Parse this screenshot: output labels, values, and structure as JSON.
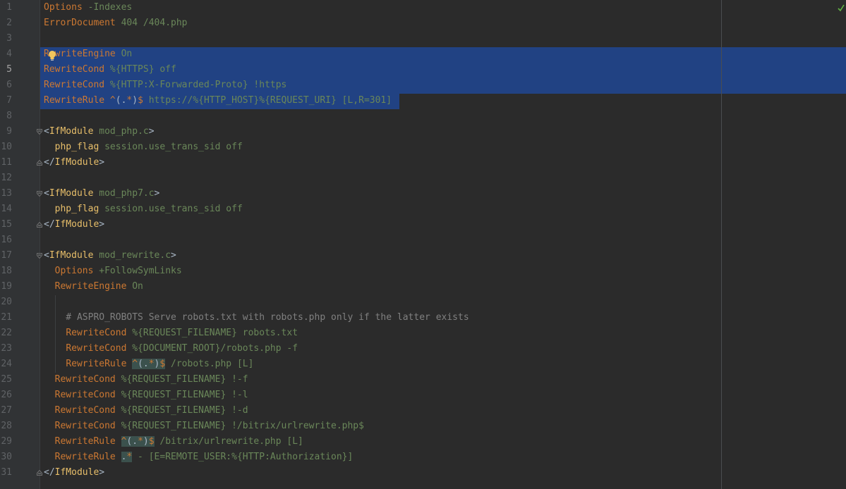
{
  "editor": {
    "current_line": 5,
    "status_icon": "check-icon",
    "lines": [
      {
        "num": "1",
        "seg": [
          {
            "t": "Options",
            "c": "kw"
          },
          {
            "t": " -Indexes",
            "c": "arg"
          }
        ]
      },
      {
        "num": "2",
        "seg": [
          {
            "t": "ErrorDocument",
            "c": "kw"
          },
          {
            "t": " 404 /404.php",
            "c": "arg"
          }
        ]
      },
      {
        "num": "3",
        "seg": []
      },
      {
        "num": "4",
        "seg": [
          {
            "t": "RewriteEngine",
            "c": "kw"
          },
          {
            "t": " On",
            "c": "arg"
          }
        ]
      },
      {
        "num": "5",
        "seg": [
          {
            "t": "RewriteCond",
            "c": "kw"
          },
          {
            "t": " %{HTTPS} off",
            "c": "arg"
          }
        ]
      },
      {
        "num": "6",
        "seg": [
          {
            "t": "RewriteCond",
            "c": "kw"
          },
          {
            "t": " %{HTTP:X-Forwarded-Proto} !https",
            "c": "arg"
          }
        ]
      },
      {
        "num": "7",
        "seg": [
          {
            "t": "RewriteRule",
            "c": "kw"
          },
          {
            "t": " ",
            "c": "arg"
          },
          {
            "t": "^",
            "c": "kw"
          },
          {
            "t": "(.",
            "c": "re"
          },
          {
            "t": "*",
            "c": "kw"
          },
          {
            "t": ")",
            "c": "re"
          },
          {
            "t": "$",
            "c": "kw"
          },
          {
            "t": " https://%{HTTP_HOST}%{REQUEST_URI} [L,R=301]",
            "c": "arg"
          }
        ]
      },
      {
        "num": "8",
        "seg": []
      },
      {
        "num": "9",
        "seg": [
          {
            "t": "<",
            "c": "re"
          },
          {
            "t": "IfModule",
            "c": "tag"
          },
          {
            "t": " mod_php.c",
            "c": "arg"
          },
          {
            "t": ">",
            "c": "re"
          }
        ],
        "fold": "open"
      },
      {
        "num": "10",
        "seg": [
          {
            "t": "  ",
            "c": "re"
          },
          {
            "t": "php_flag",
            "c": "tag"
          },
          {
            "t": " session.use_trans_sid off",
            "c": "arg"
          }
        ]
      },
      {
        "num": "11",
        "seg": [
          {
            "t": "</",
            "c": "re"
          },
          {
            "t": "IfModule",
            "c": "tag"
          },
          {
            "t": ">",
            "c": "re"
          }
        ],
        "fold": "close"
      },
      {
        "num": "12",
        "seg": []
      },
      {
        "num": "13",
        "seg": [
          {
            "t": "<",
            "c": "re"
          },
          {
            "t": "IfModule",
            "c": "tag"
          },
          {
            "t": " mod_php7.c",
            "c": "arg"
          },
          {
            "t": ">",
            "c": "re"
          }
        ],
        "fold": "open"
      },
      {
        "num": "14",
        "seg": [
          {
            "t": "  ",
            "c": "re"
          },
          {
            "t": "php_flag",
            "c": "tag"
          },
          {
            "t": " session.use_trans_sid off",
            "c": "arg"
          }
        ]
      },
      {
        "num": "15",
        "seg": [
          {
            "t": "</",
            "c": "re"
          },
          {
            "t": "IfModule",
            "c": "tag"
          },
          {
            "t": ">",
            "c": "re"
          }
        ],
        "fold": "close"
      },
      {
        "num": "16",
        "seg": []
      },
      {
        "num": "17",
        "seg": [
          {
            "t": "<",
            "c": "re"
          },
          {
            "t": "IfModule",
            "c": "tag"
          },
          {
            "t": " mod_rewrite.c",
            "c": "arg"
          },
          {
            "t": ">",
            "c": "re"
          }
        ],
        "fold": "open"
      },
      {
        "num": "18",
        "seg": [
          {
            "t": "  ",
            "c": "re"
          },
          {
            "t": "Options",
            "c": "kw"
          },
          {
            "t": " +FollowSymLinks",
            "c": "arg"
          }
        ]
      },
      {
        "num": "19",
        "seg": [
          {
            "t": "  ",
            "c": "re"
          },
          {
            "t": "RewriteEngine",
            "c": "kw"
          },
          {
            "t": " On",
            "c": "arg"
          }
        ]
      },
      {
        "num": "20",
        "seg": []
      },
      {
        "num": "21",
        "seg": [
          {
            "t": "    # ASPRO_ROBOTS Serve robots.txt with robots.php only if the latter exists",
            "c": "cmt"
          }
        ]
      },
      {
        "num": "22",
        "seg": [
          {
            "t": "    ",
            "c": "re"
          },
          {
            "t": "RewriteCond",
            "c": "kw"
          },
          {
            "t": " %{REQUEST_FILENAME} robots.txt",
            "c": "arg"
          }
        ]
      },
      {
        "num": "23",
        "seg": [
          {
            "t": "    ",
            "c": "re"
          },
          {
            "t": "RewriteCond",
            "c": "kw"
          },
          {
            "t": " %{DOCUMENT_ROOT}/robots.php -f",
            "c": "arg"
          }
        ]
      },
      {
        "num": "24",
        "seg": [
          {
            "t": "    ",
            "c": "re"
          },
          {
            "t": "RewriteRule",
            "c": "kw"
          },
          {
            "t": " ",
            "c": "arg"
          },
          {
            "t": "^",
            "c": "kw rx"
          },
          {
            "t": "(.",
            "c": "re rx"
          },
          {
            "t": "*",
            "c": "kw rx"
          },
          {
            "t": ")",
            "c": "re rx"
          },
          {
            "t": "$",
            "c": "kw rx"
          },
          {
            "t": " /robots.php [L]",
            "c": "arg"
          }
        ]
      },
      {
        "num": "25",
        "seg": [
          {
            "t": "  ",
            "c": "re"
          },
          {
            "t": "RewriteCond",
            "c": "kw"
          },
          {
            "t": " %{REQUEST_FILENAME} !-f",
            "c": "arg"
          }
        ]
      },
      {
        "num": "26",
        "seg": [
          {
            "t": "  ",
            "c": "re"
          },
          {
            "t": "RewriteCond",
            "c": "kw"
          },
          {
            "t": " %{REQUEST_FILENAME} !-l",
            "c": "arg"
          }
        ]
      },
      {
        "num": "27",
        "seg": [
          {
            "t": "  ",
            "c": "re"
          },
          {
            "t": "RewriteCond",
            "c": "kw"
          },
          {
            "t": " %{REQUEST_FILENAME} !-d",
            "c": "arg"
          }
        ]
      },
      {
        "num": "28",
        "seg": [
          {
            "t": "  ",
            "c": "re"
          },
          {
            "t": "RewriteCond",
            "c": "kw"
          },
          {
            "t": " %{REQUEST_FILENAME} !/bitrix/urlrewrite.php$",
            "c": "arg"
          }
        ]
      },
      {
        "num": "29",
        "seg": [
          {
            "t": "  ",
            "c": "re"
          },
          {
            "t": "RewriteRule",
            "c": "kw"
          },
          {
            "t": " ",
            "c": "arg"
          },
          {
            "t": "^",
            "c": "kw rx"
          },
          {
            "t": "(.",
            "c": "re rx"
          },
          {
            "t": "*",
            "c": "kw rx"
          },
          {
            "t": ")",
            "c": "re rx"
          },
          {
            "t": "$",
            "c": "kw rx"
          },
          {
            "t": " /bitrix/urlrewrite.php [L]",
            "c": "arg"
          }
        ]
      },
      {
        "num": "30",
        "seg": [
          {
            "t": "  ",
            "c": "re"
          },
          {
            "t": "RewriteRule",
            "c": "kw"
          },
          {
            "t": " ",
            "c": "arg"
          },
          {
            "t": ".",
            "c": "re rx"
          },
          {
            "t": "*",
            "c": "kw rx"
          },
          {
            "t": " - [E=REMOTE_USER:%{HTTP:Authorization}]",
            "c": "arg"
          }
        ]
      },
      {
        "num": "31",
        "seg": [
          {
            "t": "</",
            "c": "re"
          },
          {
            "t": "IfModule",
            "c": "tag"
          },
          {
            "t": ">",
            "c": "re"
          }
        ],
        "fold": "close"
      }
    ]
  }
}
